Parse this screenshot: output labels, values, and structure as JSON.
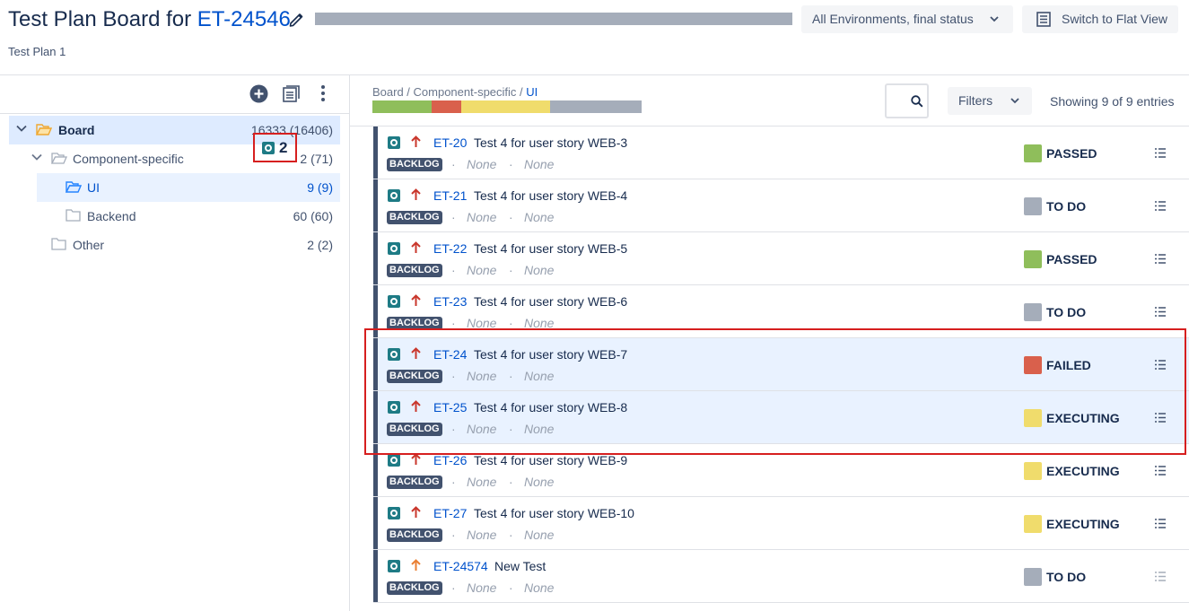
{
  "header": {
    "title_prefix": "Test Plan Board for ",
    "title_key": "ET-24546",
    "subtitle": "Test Plan 1",
    "env_button": "All Environments, final status",
    "flat_view_button": "Switch to Flat View"
  },
  "tree": {
    "overlay_count": "2",
    "items": [
      {
        "label": "Board",
        "count": "16333 (16406)"
      },
      {
        "label": "Component-specific",
        "count": "2 (71)"
      },
      {
        "label": "UI",
        "count": "9 (9)"
      },
      {
        "label": "Backend",
        "count": "60 (60)"
      },
      {
        "label": "Other",
        "count": "2 (2)"
      }
    ]
  },
  "main": {
    "breadcrumb_path": "Board / Component-specific / ",
    "breadcrumb_current": "UI",
    "filters_label": "Filters",
    "showing_text": "Showing 9 of 9 entries",
    "status_mix": [
      {
        "status": "PASSED",
        "share": 0.22,
        "color": "#8fbe5b"
      },
      {
        "status": "FAILED",
        "share": 0.11,
        "color": "#d9604c"
      },
      {
        "status": "EXECUTING",
        "share": 0.33,
        "color": "#f0dc6c"
      },
      {
        "status": "TO DO",
        "share": 0.34,
        "color": "#a5adba"
      }
    ]
  },
  "tests": [
    {
      "key": "ET-20",
      "summary": "Test 4 for user story WEB-3",
      "priority": "high",
      "badge": "BACKLOG",
      "field1": "None",
      "field2": "None",
      "status": "PASSED",
      "status_color": "#8fbe5b"
    },
    {
      "key": "ET-21",
      "summary": "Test 4 for user story WEB-4",
      "priority": "high",
      "badge": "BACKLOG",
      "field1": "None",
      "field2": "None",
      "status": "TO DO",
      "status_color": "#a5adba"
    },
    {
      "key": "ET-22",
      "summary": "Test 4 for user story WEB-5",
      "priority": "high",
      "badge": "BACKLOG",
      "field1": "None",
      "field2": "None",
      "status": "PASSED",
      "status_color": "#8fbe5b"
    },
    {
      "key": "ET-23",
      "summary": "Test 4 for user story WEB-6",
      "priority": "high",
      "badge": "BACKLOG",
      "field1": "None",
      "field2": "None",
      "status": "TO DO",
      "status_color": "#a5adba"
    },
    {
      "key": "ET-24",
      "summary": "Test 4 for user story WEB-7",
      "priority": "high",
      "badge": "BACKLOG",
      "field1": "None",
      "field2": "None",
      "status": "FAILED",
      "status_color": "#d9604c"
    },
    {
      "key": "ET-25",
      "summary": "Test 4 for user story WEB-8",
      "priority": "high",
      "badge": "BACKLOG",
      "field1": "None",
      "field2": "None",
      "status": "EXECUTING",
      "status_color": "#f0dc6c"
    },
    {
      "key": "ET-26",
      "summary": "Test 4 for user story WEB-9",
      "priority": "high",
      "badge": "BACKLOG",
      "field1": "None",
      "field2": "None",
      "status": "EXECUTING",
      "status_color": "#f0dc6c"
    },
    {
      "key": "ET-27",
      "summary": "Test 4 for user story WEB-10",
      "priority": "high",
      "badge": "BACKLOG",
      "field1": "None",
      "field2": "None",
      "status": "EXECUTING",
      "status_color": "#f0dc6c"
    },
    {
      "key": "ET-24574",
      "summary": "New Test",
      "priority": "medium",
      "badge": "BACKLOG",
      "field1": "None",
      "field2": "None",
      "status": "TO DO",
      "status_color": "#a5adba"
    }
  ],
  "colors": {
    "link": "#0052cc",
    "priority_high": "#c9372c",
    "priority_medium": "#e97f33",
    "highlight_border": "#d61f1f"
  }
}
